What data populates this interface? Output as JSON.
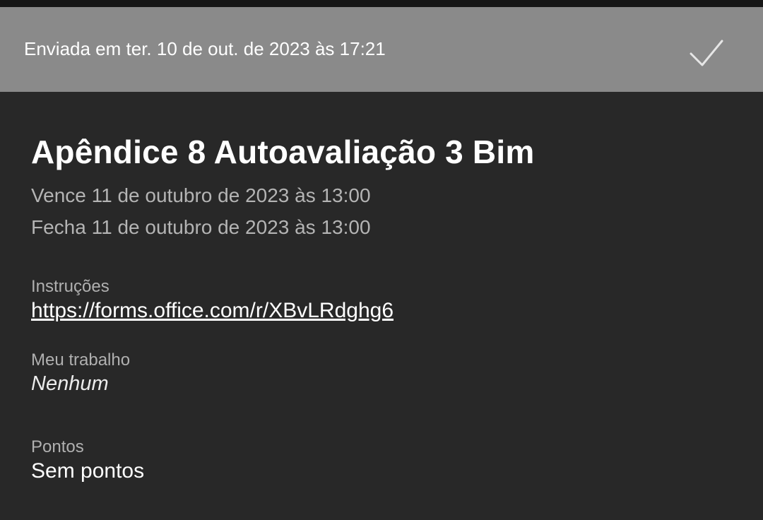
{
  "banner": {
    "submitted_text": "Enviada em ter. 10 de out. de 2023 às 17:21",
    "status_icon": "checkmark-icon"
  },
  "assignment": {
    "title": "Apêndice 8 Autoavaliação 3 Bim",
    "due": "Vence 11 de outubro de 2023 às 13:00",
    "close": "Fecha 11 de outubro de 2023 às 13:00"
  },
  "instructions": {
    "label": "Instruções",
    "link": "https://forms.office.com/r/XBvLRdghg6"
  },
  "my_work": {
    "label": "Meu trabalho",
    "value": "Nenhum"
  },
  "points": {
    "label": "Pontos",
    "value": "Sem pontos"
  },
  "colors": {
    "background": "#282828",
    "banner": "#8a8a8a",
    "text_primary": "#ffffff",
    "text_secondary": "#b4b4b4"
  }
}
